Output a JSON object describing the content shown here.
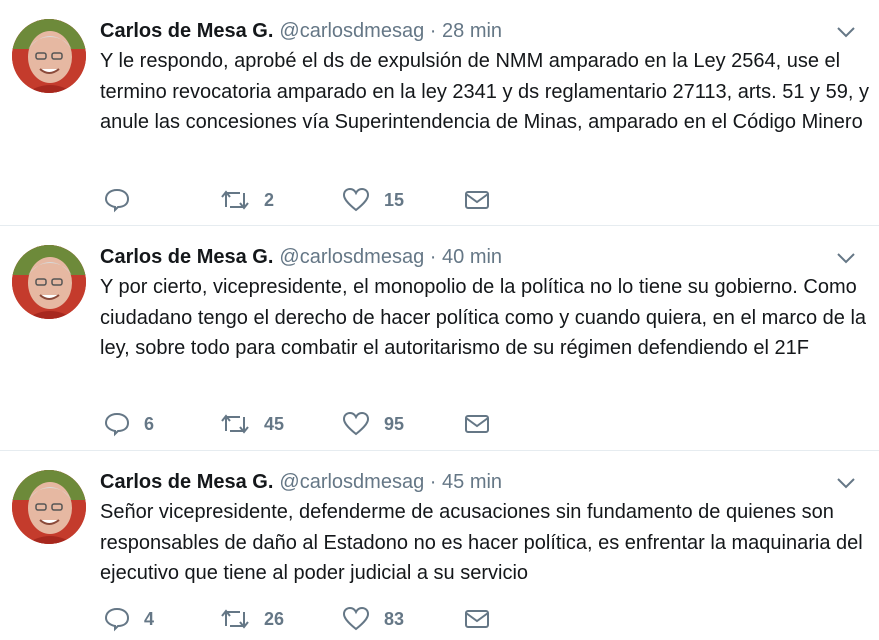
{
  "tweets": [
    {
      "name": "Carlos de Mesa G.",
      "handle": "@carlosdmesag",
      "separator": "·",
      "time": "28 min",
      "text": "Y le respondo, aprobé el ds de expulsión de NMM amparado en la Ley 2564, use el termino revocatoria amparado en la ley 2341 y ds reglamentario 27113, arts. 51 y 59, y anule las concesiones vía Superintendencia de Minas, amparado en el Código Minero",
      "replies": "",
      "retweets": "2",
      "likes": "15"
    },
    {
      "name": "Carlos de Mesa G.",
      "handle": "@carlosdmesag",
      "separator": "·",
      "time": "40 min",
      "text": "Y por cierto, vicepresidente, el monopolio de la política no lo tiene su gobierno. Como ciudadano tengo el derecho de hacer política como y cuando quiera, en el marco de la ley, sobre todo para combatir el autoritarismo de su régimen defendiendo el 21F",
      "replies": "6",
      "retweets": "45",
      "likes": "95"
    },
    {
      "name": "Carlos de Mesa G.",
      "handle": "@carlosdmesag",
      "separator": "·",
      "time": "45 min",
      "text": "Señor vicepresidente, defenderme de acusaciones sin fundamento de quienes son responsables de daño al Estadono no es hacer política, es enfrentar la maquinaria del ejecutivo que tiene al poder judicial a su servicio",
      "replies": "4",
      "retweets": "26",
      "likes": "83"
    }
  ],
  "icons": {
    "reply": "reply-icon",
    "retweet": "retweet-icon",
    "like": "heart-icon",
    "message": "envelope-icon",
    "more": "chevron-down-icon"
  },
  "colors": {
    "text": "#14171a",
    "secondary": "#657786",
    "divider": "#e6ecf0",
    "avatar_bg": "#c43b2c"
  }
}
